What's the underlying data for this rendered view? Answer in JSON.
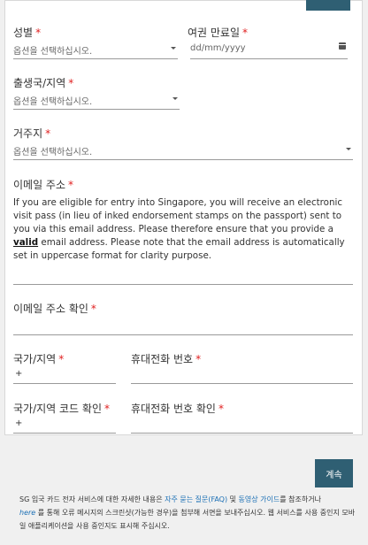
{
  "form": {
    "gender": {
      "label": "성별",
      "placeholder": "옵션을 선택하십시오."
    },
    "passport_expiry": {
      "label": "여권 만료일",
      "placeholder": "dd/mm/yyyy"
    },
    "country_of_birth": {
      "label": "출생국/지역",
      "placeholder": "옵션을 선택하십시오."
    },
    "residence": {
      "label": "거주지",
      "placeholder": "옵션을 선택하십시오."
    },
    "email": {
      "label": "이메일 주소",
      "desc_1": "If you are eligible for entry into Singapore, you will receive an electronic visit pass (in lieu of inked endorsement stamps on the passport) sent to you via this email address. Please therefore ensure that you provide a ",
      "desc_bold": "valid",
      "desc_2": " email address. Please note that the email address is automatically set in uppercase format for clarity purpose."
    },
    "email_confirm": {
      "label": "이메일 주소 확인"
    },
    "country_code": {
      "label": "국가/지역",
      "value": "+"
    },
    "mobile": {
      "label": "휴대전화 번호"
    },
    "country_code_confirm": {
      "label": "국가/지역 코드 확인",
      "value": "+"
    },
    "mobile_confirm": {
      "label": "휴대전화 번호 확인"
    },
    "required_mark": "*"
  },
  "continue_label": "계속",
  "footer": {
    "t1": "SG 입국 카드 전자 서비스에 대한 자세한 내용은 ",
    "faq": "자주 묻는 질문(FAQ)",
    "t2": " 및 ",
    "video": "동영상 가이드",
    "t3": "를 참조하거나",
    "here": "here",
    "t4": " 를 통해 오류 메시지의 스크린샷(가능한 경우)을 첨부해 서면을 보내주십시오. 웹 서비스를 사용 중인지 모바일 애플리케이션을 사용 중인지도 표시해 주십시오."
  }
}
